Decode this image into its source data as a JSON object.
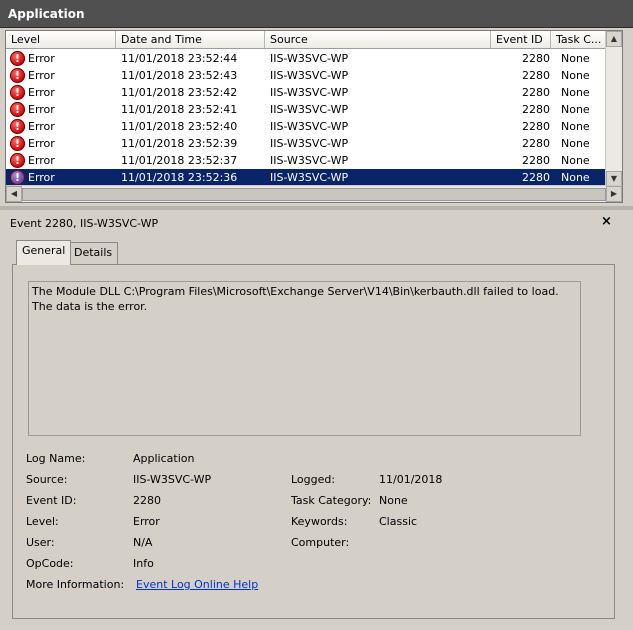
{
  "window": {
    "title": "Application"
  },
  "columns": [
    "Level",
    "Date and Time",
    "Source",
    "Event ID",
    "Task C..."
  ],
  "rows": [
    {
      "level": "Error",
      "datetime": "11/01/2018 23:52:44",
      "source": "IIS-W3SVC-WP",
      "event_id": "2280",
      "task": "None"
    },
    {
      "level": "Error",
      "datetime": "11/01/2018 23:52:43",
      "source": "IIS-W3SVC-WP",
      "event_id": "2280",
      "task": "None"
    },
    {
      "level": "Error",
      "datetime": "11/01/2018 23:52:42",
      "source": "IIS-W3SVC-WP",
      "event_id": "2280",
      "task": "None"
    },
    {
      "level": "Error",
      "datetime": "11/01/2018 23:52:41",
      "source": "IIS-W3SVC-WP",
      "event_id": "2280",
      "task": "None"
    },
    {
      "level": "Error",
      "datetime": "11/01/2018 23:52:40",
      "source": "IIS-W3SVC-WP",
      "event_id": "2280",
      "task": "None"
    },
    {
      "level": "Error",
      "datetime": "11/01/2018 23:52:39",
      "source": "IIS-W3SVC-WP",
      "event_id": "2280",
      "task": "None"
    },
    {
      "level": "Error",
      "datetime": "11/01/2018 23:52:37",
      "source": "IIS-W3SVC-WP",
      "event_id": "2280",
      "task": "None"
    },
    {
      "level": "Error",
      "datetime": "11/01/2018 23:52:36",
      "source": "IIS-W3SVC-WP",
      "event_id": "2280",
      "task": "None",
      "selected": true
    }
  ],
  "detail": {
    "title": "Event 2280, IIS-W3SVC-WP",
    "close": "×",
    "tabs": [
      "General",
      "Details"
    ],
    "active_tab": "General",
    "description": "The Module DLL C:\\Program Files\\Microsoft\\Exchange Server\\V14\\Bin\\kerbauth.dll failed to load.  The data is the error.",
    "fields": {
      "log_name_label": "Log Name:",
      "log_name": "Application",
      "source_label": "Source:",
      "source": "IIS-W3SVC-WP",
      "event_id_label": "Event ID:",
      "event_id": "2280",
      "level_label": "Level:",
      "level": "Error",
      "user_label": "User:",
      "user": "N/A",
      "opcode_label": "OpCode:",
      "opcode": "Info",
      "more_info_label": "More Information:",
      "more_info_link": "Event Log Online Help",
      "logged_label": "Logged:",
      "logged": "11/01/2018",
      "task_category_label": "Task Category:",
      "task_category": "None",
      "keywords_label": "Keywords:",
      "keywords": "Classic",
      "computer_label": "Computer:",
      "computer": ""
    }
  },
  "icons": {
    "row_level": "error-icon",
    "close": "close-icon"
  }
}
